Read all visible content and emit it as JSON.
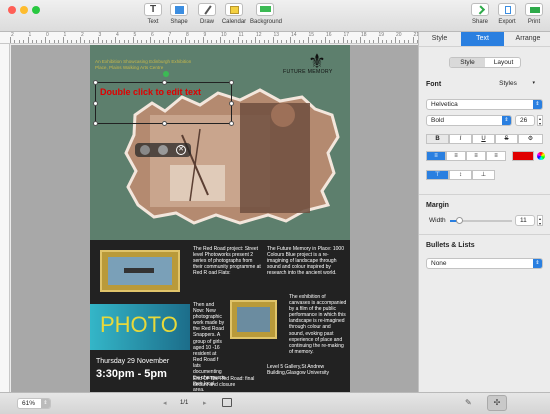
{
  "toolbar": {
    "text": "Text",
    "shape": "Shape",
    "draw": "Draw",
    "calendar": "Calendar",
    "background": "Background",
    "share": "Share",
    "export": "Export",
    "print": "Print"
  },
  "ruler": {
    "ticks": [
      "2",
      "1",
      "0",
      "1",
      "2",
      "3",
      "4",
      "5",
      "6",
      "7",
      "8",
      "9",
      "10",
      "11",
      "12",
      "13",
      "14",
      "15",
      "16",
      "17",
      "18",
      "19",
      "20",
      "21",
      "22"
    ]
  },
  "poster": {
    "top_left_text": "An Exhibition Showcasing Edinburgh Exhibition\nPlace, Plains Walking Arts Centre",
    "brand": "FUTURE MEMORY",
    "fleur": "⚜",
    "placeholder": "Double click to edit text",
    "col1_a": "The Red Road project: Street level Photoworks present 2 series of photographs from their community programme at Red R oad Flats:",
    "col1_b": "Then and Now: New photographic work made by the Red Road Snappers. A group of girls aged 10 -16 resident at Red Road f lats documenting the changes in their local area.",
    "col1_c": "End Of The Red Road: final decant and closure",
    "col2_a": "The Future Memory in Place: 1000 Colours Blue project is a re-imagining of landscape through sound and colour inspired by research into the ancient world.",
    "col2_b": "The exhibition of canvases is accompanied by a film of the public performance in which this landscape is re-imagined through colour and sound, evoking past experience of place and continuing the re-making of memory.",
    "col2_c": "Level 5 Gallery,St Andrew Building,Glasgow University",
    "photo": "PHOTO",
    "date": "Thursday 29 November",
    "time": "3:30pm - 5pm"
  },
  "inspector": {
    "tabs": [
      "Style",
      "Text",
      "Arrange"
    ],
    "active_tab": "Text",
    "subtabs": [
      "Style",
      "Layout"
    ],
    "font_label": "Font",
    "styles_label": "Styles",
    "font_family": "Helvetica",
    "font_weight": "Bold",
    "font_size": "26",
    "format_buttons": [
      "B",
      "I",
      "U",
      "S",
      "⚙"
    ],
    "margin_label": "Margin",
    "width_label": "Width",
    "width_value": "11",
    "width_fraction": 0.15,
    "bullets_label": "Bullets & Lists",
    "bullets_value": "None",
    "text_color": "#e00000",
    "accent": "#2a7fe0"
  },
  "status": {
    "zoom": "61%",
    "pages": "1/1"
  }
}
